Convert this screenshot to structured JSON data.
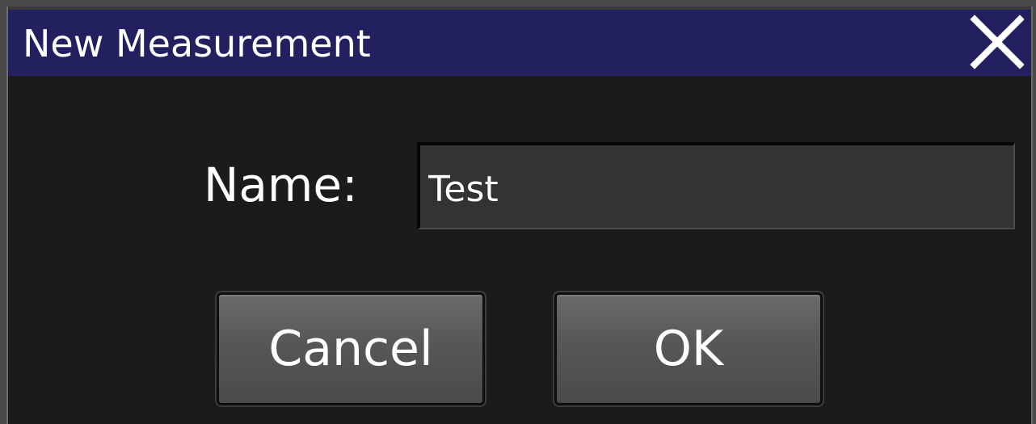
{
  "dialog": {
    "title": "New Measurement",
    "close_icon": "close-icon"
  },
  "form": {
    "name_label": "Name:",
    "name_value": "Test"
  },
  "buttons": {
    "cancel_label": "Cancel",
    "ok_label": "OK"
  },
  "colors": {
    "title_bar": "#22205f",
    "dialog_background": "#1b1b1b",
    "input_background": "#333333",
    "text": "#ffffff"
  }
}
